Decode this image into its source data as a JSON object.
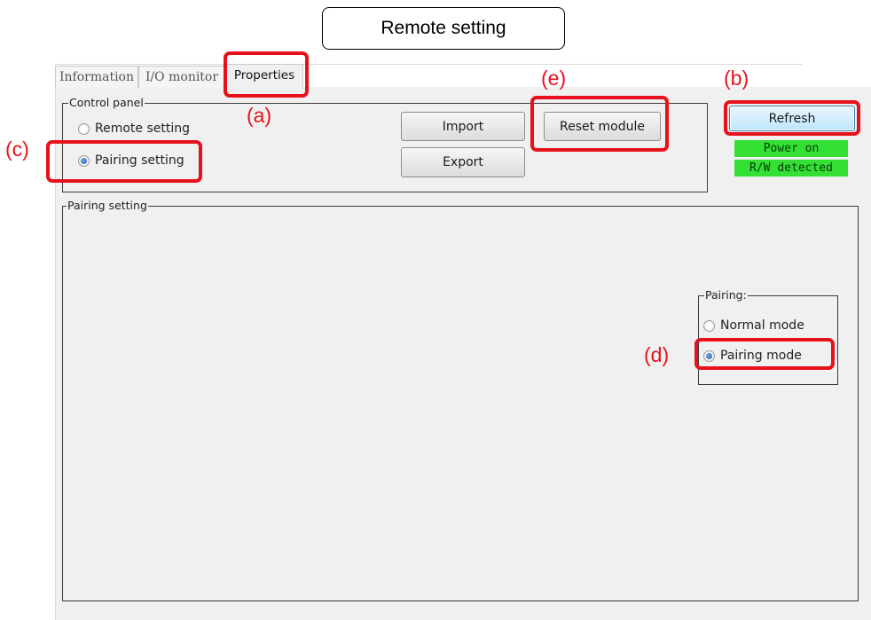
{
  "heading": "Remote setting",
  "tabs": [
    {
      "label": "Information",
      "active": false
    },
    {
      "label": "I/O monitor",
      "active": false
    },
    {
      "label": "Properties",
      "active": true
    }
  ],
  "control_panel": {
    "title": "Control panel",
    "radios": [
      {
        "label": "Remote setting",
        "selected": false
      },
      {
        "label": "Pairing setting",
        "selected": true
      }
    ],
    "import_label": "Import",
    "export_label": "Export",
    "reset_label": "Reset module"
  },
  "refresh_label": "Refresh",
  "status": {
    "power": "Power on",
    "rw": "R/W detected",
    "color": "#33e033"
  },
  "pairing_setting": {
    "title": "Pairing setting",
    "pairing_group": {
      "title": "Pairing:",
      "radios": [
        {
          "label": "Normal mode",
          "selected": false
        },
        {
          "label": "Pairing mode",
          "selected": true
        }
      ]
    }
  },
  "annotations": {
    "a": "(a)",
    "b": "(b)",
    "c": "(c)",
    "d": "(d)",
    "e": "(e)",
    "color": "#e8111b"
  }
}
